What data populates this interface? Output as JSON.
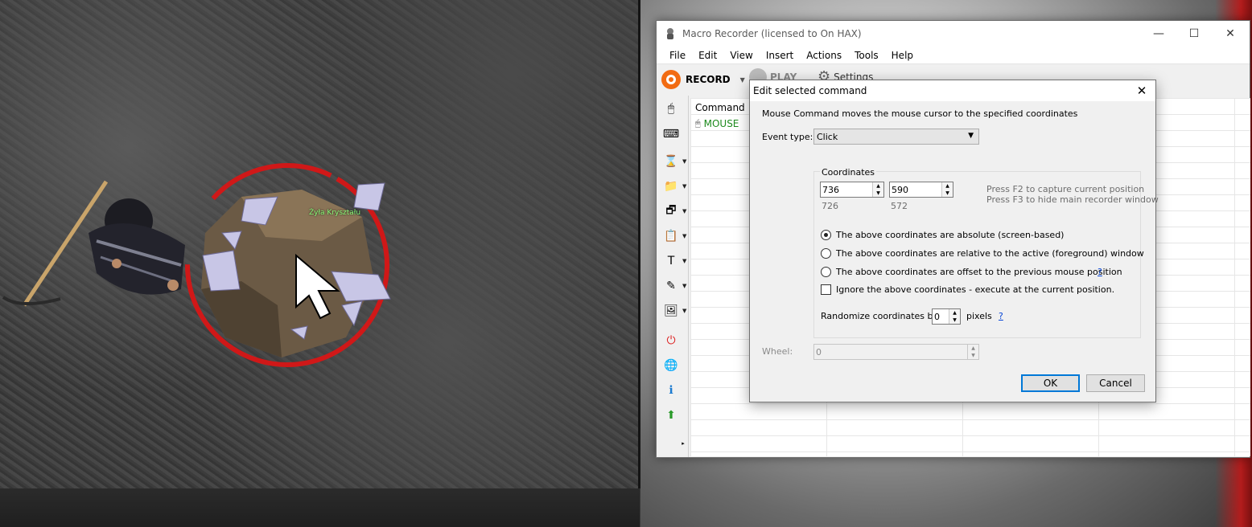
{
  "game": {
    "ore_label": "Żyła Kryształu"
  },
  "app": {
    "title": "Macro Recorder (licensed to On HAX)",
    "window_controls": {
      "minimize": "—",
      "maximize": "☐",
      "close": "✕"
    },
    "menu": [
      "File",
      "Edit",
      "View",
      "Insert",
      "Actions",
      "Tools",
      "Help"
    ],
    "toolbar": {
      "record_label": "RECORD",
      "play_label": "PLAY",
      "settings_label": "Settings"
    },
    "grid": {
      "column_header": "Command",
      "rows": [
        {
          "command": "MOUSE"
        }
      ]
    },
    "sidebar_icons": [
      "mouse-icon",
      "keyboard-icon",
      "hourglass-icon",
      "folder-icon",
      "window-icon",
      "clipboard-icon",
      "text-icon",
      "eyedropper-icon",
      "image-icon",
      "stop-icon",
      "web-icon",
      "info-icon",
      "arrow-up-icon"
    ]
  },
  "dialog": {
    "title": "Edit selected command",
    "close_glyph": "✕",
    "description": "Mouse Command moves the mouse cursor to the specified coordinates",
    "event_type_label": "Event type:",
    "event_type_value": "Click",
    "coordinates_label": "Coordinates",
    "x_value": "736",
    "y_value": "590",
    "x_hint": "726",
    "y_hint": "572",
    "hint_f2": "Press F2 to capture current position",
    "hint_f3": "Press F3 to hide main recorder window",
    "radio_absolute": "The above coordinates are absolute (screen-based)",
    "radio_relative": "The above coordinates are relative to the active (foreground) window",
    "radio_offset": "The above coordinates are offset to the previous mouse position",
    "help_glyph": "?",
    "ignore_label": "Ignore the above coordinates - execute at the current position.",
    "randomize_label": "Randomize coordinates by",
    "randomize_value": "0",
    "pixels_label": "pixels",
    "wheel_label": "Wheel:",
    "wheel_value": "0",
    "ok_label": "OK",
    "cancel_label": "Cancel",
    "selected_radio": "absolute",
    "ignore_checked": false
  },
  "colors": {
    "record": "#f26b12",
    "link": "#0645d6",
    "mouse_row": "#1e8a1e",
    "ring": "#d01818"
  }
}
